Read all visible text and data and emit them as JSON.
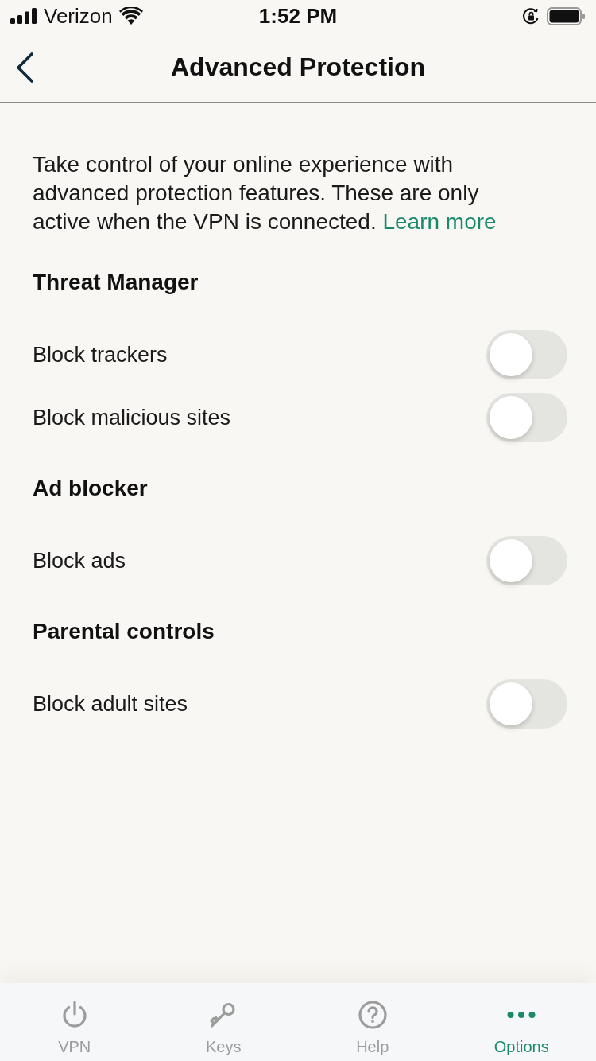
{
  "status_bar": {
    "carrier": "Verizon",
    "time": "1:52 PM"
  },
  "nav": {
    "title": "Advanced Protection"
  },
  "intro": {
    "text": "Take control of your online experience with advanced protection features. These are only active when the VPN is connected.",
    "link": "Learn more"
  },
  "sections": [
    {
      "title": "Threat Manager",
      "items": [
        {
          "label": "Block trackers",
          "on": false
        },
        {
          "label": "Block malicious sites",
          "on": false
        }
      ]
    },
    {
      "title": "Ad blocker",
      "items": [
        {
          "label": "Block ads",
          "on": false
        }
      ]
    },
    {
      "title": "Parental controls",
      "items": [
        {
          "label": "Block adult sites",
          "on": false
        }
      ]
    }
  ],
  "tab_bar": [
    {
      "label": "VPN",
      "kind": "power",
      "selected": false
    },
    {
      "label": "Keys",
      "kind": "key",
      "selected": false
    },
    {
      "label": "Help",
      "kind": "help",
      "selected": false
    },
    {
      "label": "Options",
      "kind": "more",
      "selected": true
    }
  ]
}
